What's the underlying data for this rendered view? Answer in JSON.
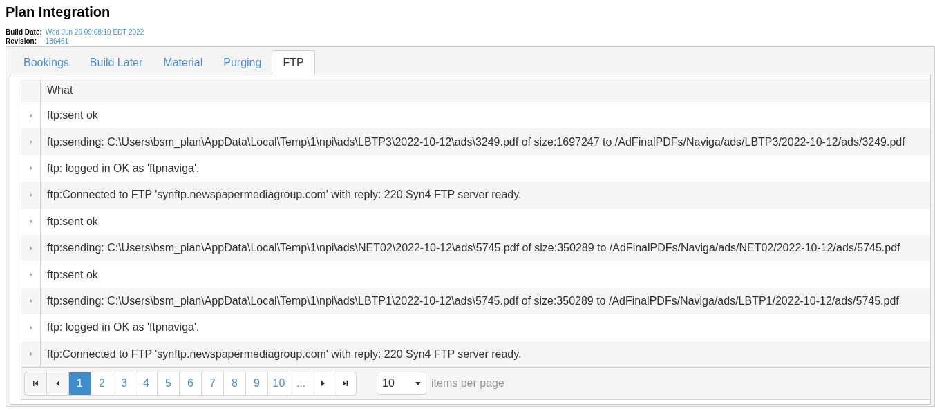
{
  "title": "Plan Integration",
  "build_info": [
    {
      "label": "Build Date:",
      "value": "Wed Jun 29 09:08:10 EDT 2022"
    },
    {
      "label": "Revision:",
      "value": "136461"
    }
  ],
  "tabs": [
    {
      "label": "Bookings",
      "selected": false
    },
    {
      "label": "Build Later",
      "selected": false
    },
    {
      "label": "Material",
      "selected": false
    },
    {
      "label": "Purging",
      "selected": false
    },
    {
      "label": "FTP",
      "selected": true
    }
  ],
  "table": {
    "columns": [
      "What"
    ],
    "rows": [
      {
        "what": "ftp:sent ok"
      },
      {
        "what": "ftp:sending: C:\\Users\\bsm_plan\\AppData\\Local\\Temp\\1\\npi\\ads\\LBTP3\\2022-10-12\\ads\\3249.pdf of size:1697247 to /AdFinalPDFs/Naviga/ads/LBTP3/2022-10-12/ads/3249.pdf"
      },
      {
        "what": "ftp: logged in OK as 'ftpnaviga'."
      },
      {
        "what": "ftp:Connected to FTP 'synftp.newspapermediagroup.com' with reply: 220 Syn4 FTP server ready."
      },
      {
        "what": "ftp:sent ok"
      },
      {
        "what": "ftp:sending: C:\\Users\\bsm_plan\\AppData\\Local\\Temp\\1\\npi\\ads\\NET02\\2022-10-12\\ads\\5745.pdf of size:350289 to /AdFinalPDFs/Naviga/ads/NET02/2022-10-12/ads/5745.pdf"
      },
      {
        "what": "ftp:sent ok"
      },
      {
        "what": "ftp:sending: C:\\Users\\bsm_plan\\AppData\\Local\\Temp\\1\\npi\\ads\\LBTP1\\2022-10-12\\ads\\5745.pdf of size:350289 to /AdFinalPDFs/Naviga/ads/LBTP1/2022-10-12/ads/5745.pdf"
      },
      {
        "what": "ftp: logged in OK as 'ftpnaviga'."
      },
      {
        "what": "ftp:Connected to FTP 'synftp.newspapermediagroup.com' with reply: 220 Syn4 FTP server ready."
      }
    ]
  },
  "pager": {
    "items": [
      {
        "kind": "first"
      },
      {
        "kind": "prev"
      },
      {
        "kind": "page",
        "label": "1",
        "selected": true
      },
      {
        "kind": "page",
        "label": "2",
        "selected": false
      },
      {
        "kind": "page",
        "label": "3",
        "selected": false
      },
      {
        "kind": "page",
        "label": "4",
        "selected": false
      },
      {
        "kind": "page",
        "label": "5",
        "selected": false
      },
      {
        "kind": "page",
        "label": "6",
        "selected": false
      },
      {
        "kind": "page",
        "label": "7",
        "selected": false
      },
      {
        "kind": "page",
        "label": "8",
        "selected": false
      },
      {
        "kind": "page",
        "label": "9",
        "selected": false
      },
      {
        "kind": "page",
        "label": "10",
        "selected": false
      },
      {
        "kind": "page",
        "label": "...",
        "selected": false
      },
      {
        "kind": "next"
      },
      {
        "kind": "last"
      }
    ],
    "page_size": "10",
    "page_size_label": "items per page"
  }
}
